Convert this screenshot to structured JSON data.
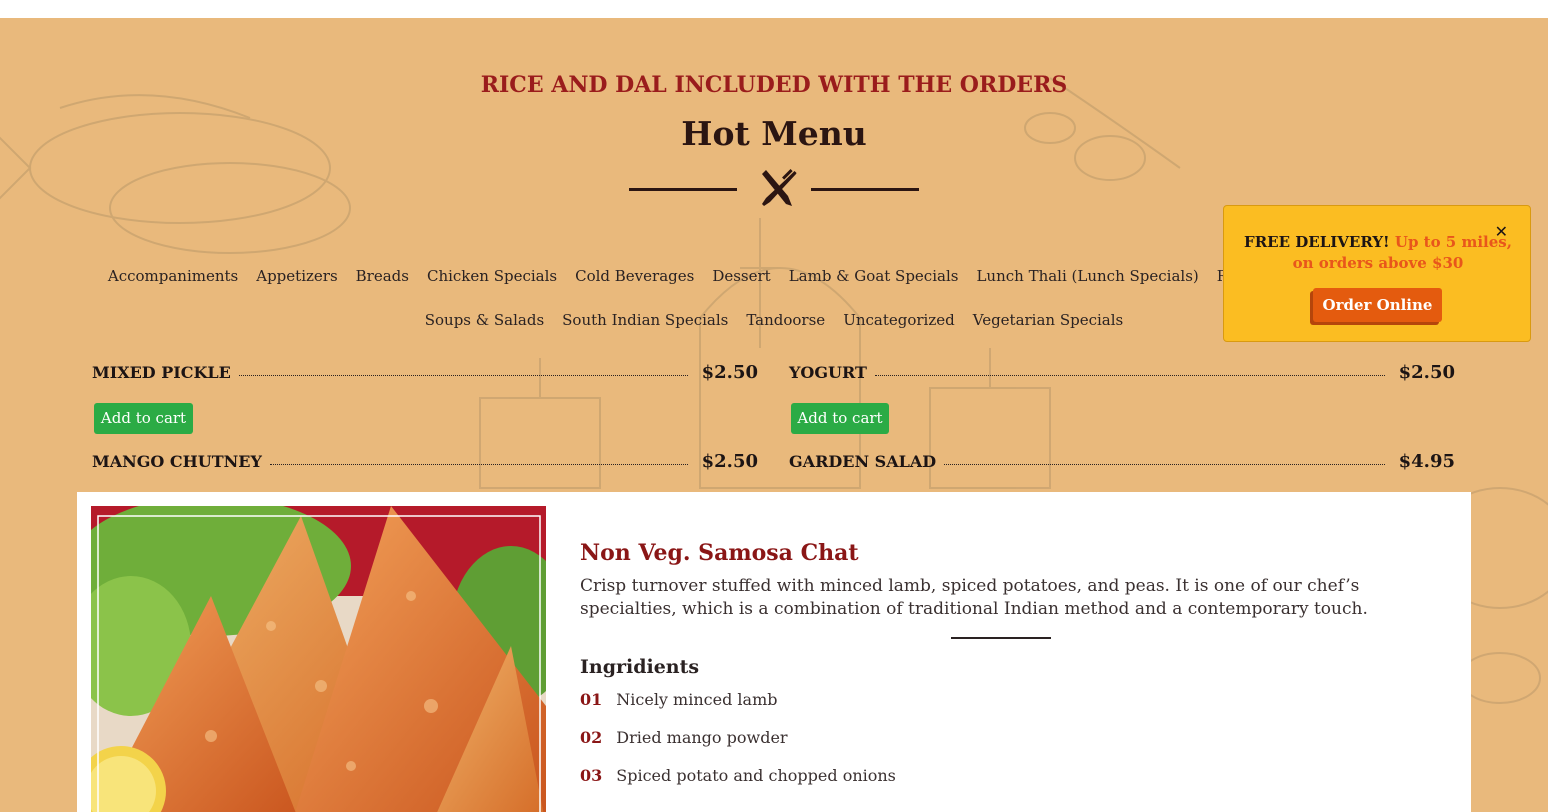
{
  "section": {
    "subtitle": "RICE AND DAL INCLUDED WITH THE ORDERS",
    "title": "Hot Menu"
  },
  "categories_row1": [
    "Accompaniments",
    "Appetizers",
    "Breads",
    "Chicken Specials",
    "Cold Beverages",
    "Dessert",
    "Lamb & Goat Specials",
    "Lunch Thali (Lunch Specials)",
    "Rice"
  ],
  "categories_row2": [
    "Soups & Salads",
    "South Indian Specials",
    "Tandoorse",
    "Uncategorized",
    "Vegetarian Specials"
  ],
  "menu_items": [
    {
      "name": "MIXED PICKLE",
      "price": "$2.50",
      "button": "Add to cart"
    },
    {
      "name": "YOGURT",
      "price": "$2.50",
      "button": "Add to cart"
    },
    {
      "name": "MANGO CHUTNEY",
      "price": "$2.50"
    },
    {
      "name": "GARDEN SALAD",
      "price": "$4.95"
    }
  ],
  "featured": {
    "title": "Non Veg. Samosa Chat",
    "description": "Crisp turnover stuffed with minced lamb, spiced potatoes, and peas. It is one of our chef’s specialties, which is a combination of traditional Indian method and a contemporary touch.",
    "ingredients_heading": "Ingridients",
    "ingredients": [
      {
        "num": "01",
        "text": "Nicely minced lamb"
      },
      {
        "num": "02",
        "text": "Dried mango powder"
      },
      {
        "num": "03",
        "text": "Spiced potato and chopped onions"
      }
    ]
  },
  "promo": {
    "close": "✕",
    "lead": "FREE DELIVERY!",
    "highlight": "Up to 5 miles, on orders above $30",
    "button": "Order Online"
  },
  "colors": {
    "background": "#e9b97c",
    "accent_red": "#9a1c1c",
    "cart_green": "#2bab45",
    "promo_yellow": "#fbbd22",
    "promo_orange": "#e45b0e"
  },
  "icons": [
    "utensils-icon",
    "close-icon"
  ]
}
